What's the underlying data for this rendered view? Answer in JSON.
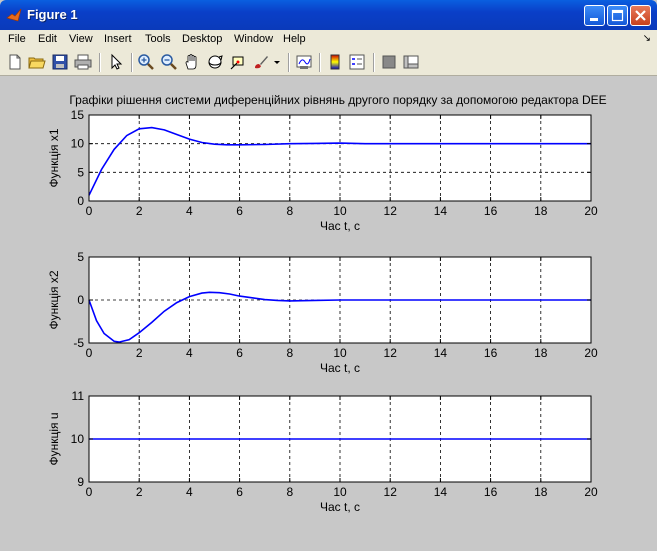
{
  "window": {
    "title": "Figure 1",
    "colors": {
      "titlebar": "#0a3fc8",
      "figure_bg": "#c8c8c8",
      "line": "#0000ff"
    }
  },
  "menu": {
    "items": [
      "File",
      "Edit",
      "View",
      "Insert",
      "Tools",
      "Desktop",
      "Window",
      "Help"
    ]
  },
  "toolbar": {
    "icons": [
      "new-file-icon",
      "open-file-icon",
      "save-icon",
      "print-icon",
      "arrow-cursor-icon",
      "zoom-in-icon",
      "zoom-out-icon",
      "pan-hand-icon",
      "rotate-3d-icon",
      "data-cursor-icon",
      "brush-icon",
      "link-plot-icon",
      "colorbar-icon",
      "legend-icon",
      "hide-plot-tools-icon",
      "show-plot-tools-icon"
    ]
  },
  "figure": {
    "title": "Графіки рішення системи диференційних рівнянь другого порядку за допомогою редактора DEE"
  },
  "chart_data": [
    {
      "type": "line",
      "xlabel": "Час t, c",
      "ylabel": "Функція x1",
      "xlim": [
        0,
        20
      ],
      "ylim": [
        0,
        15
      ],
      "xticks": [
        0,
        2,
        4,
        6,
        8,
        10,
        12,
        14,
        16,
        18,
        20
      ],
      "yticks": [
        0,
        5,
        10,
        15
      ],
      "grid": true,
      "x": [
        0,
        0.5,
        1,
        1.5,
        2,
        2.5,
        3,
        3.5,
        4,
        4.5,
        5,
        5.5,
        6,
        7,
        8,
        9,
        10,
        11,
        12,
        14,
        16,
        18,
        20
      ],
      "values": [
        1,
        5.5,
        9,
        11.4,
        12.6,
        12.8,
        12.4,
        11.6,
        10.8,
        10.2,
        9.9,
        9.8,
        9.8,
        9.85,
        10,
        10.05,
        10.1,
        10,
        10,
        10,
        10,
        10,
        10
      ]
    },
    {
      "type": "line",
      "xlabel": "Час t, c",
      "ylabel": "Функція x2",
      "xlim": [
        0,
        20
      ],
      "ylim": [
        -5,
        5
      ],
      "xticks": [
        0,
        2,
        4,
        6,
        8,
        10,
        12,
        14,
        16,
        18,
        20
      ],
      "yticks": [
        -5,
        0,
        5
      ],
      "grid": true,
      "x": [
        0,
        0.3,
        0.6,
        1,
        1.2,
        1.6,
        2,
        2.5,
        3,
        3.5,
        4,
        4.5,
        4.8,
        5.2,
        5.6,
        6,
        6.5,
        7,
        7.5,
        8,
        9,
        10,
        12,
        14,
        16,
        18,
        20
      ],
      "values": [
        0,
        -2.4,
        -3.9,
        -4.8,
        -4.9,
        -4.6,
        -3.8,
        -2.6,
        -1.3,
        -0.3,
        0.4,
        0.8,
        0.9,
        0.85,
        0.7,
        0.45,
        0.25,
        0.05,
        -0.05,
        -0.1,
        -0.05,
        0,
        0,
        0,
        0,
        0,
        0
      ]
    },
    {
      "type": "line",
      "xlabel": "Час t, c",
      "ylabel": "Функція u",
      "xlim": [
        0,
        20
      ],
      "ylim": [
        9,
        11
      ],
      "xticks": [
        0,
        2,
        4,
        6,
        8,
        10,
        12,
        14,
        16,
        18,
        20
      ],
      "yticks": [
        9,
        10,
        11
      ],
      "grid": true,
      "x": [
        0,
        20
      ],
      "values": [
        10,
        10
      ]
    }
  ]
}
